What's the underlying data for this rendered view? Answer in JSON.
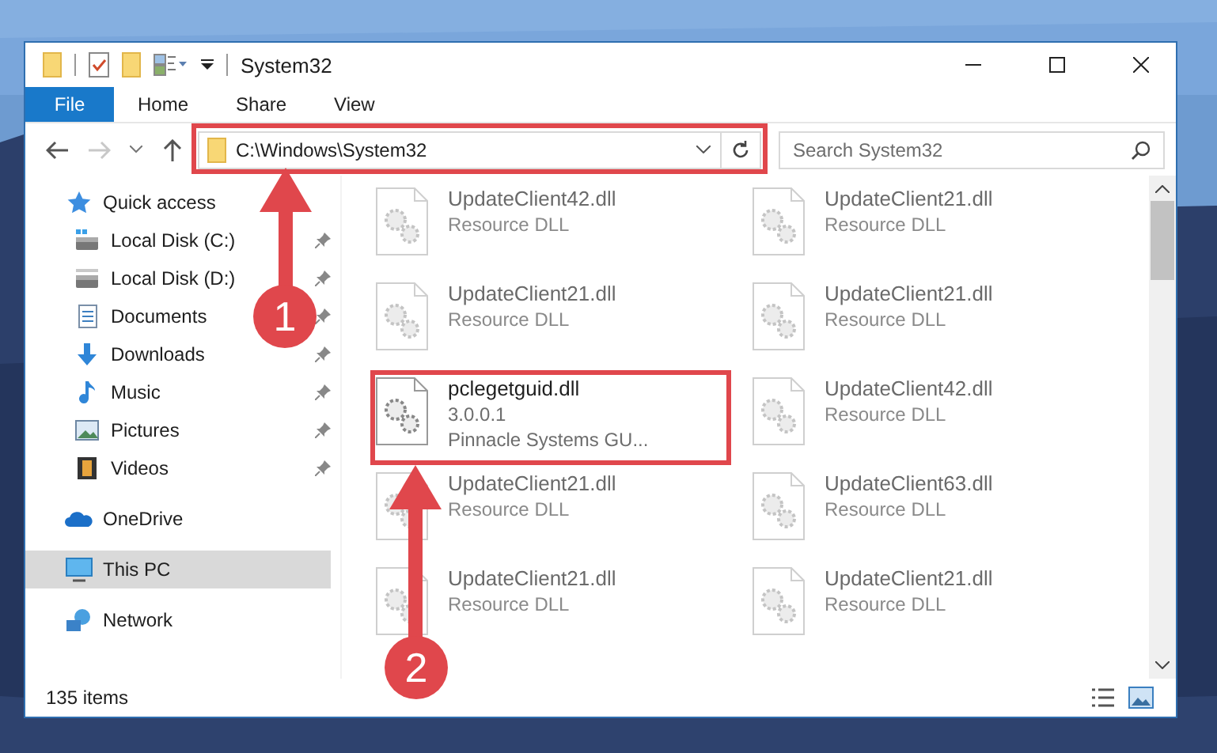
{
  "window": {
    "title": "System32"
  },
  "ribbon_tabs": [
    {
      "label": "File",
      "kind": "file",
      "selected": false
    },
    {
      "label": "Home",
      "kind": "tab",
      "selected": false
    },
    {
      "label": "Share",
      "kind": "tab",
      "selected": false
    },
    {
      "label": "View",
      "kind": "tab",
      "selected": false
    }
  ],
  "address": {
    "path": "C:\\Windows\\System32"
  },
  "search": {
    "placeholder": "Search System32"
  },
  "nav": [
    {
      "label": "Quick access",
      "selected": false,
      "children": [
        {
          "label": "Local Disk (C:)",
          "pinned": true,
          "selected": false
        },
        {
          "label": "Local Disk (D:)",
          "pinned": true,
          "selected": false
        },
        {
          "label": "Documents",
          "pinned": true,
          "selected": false
        },
        {
          "label": "Downloads",
          "pinned": true,
          "selected": false
        },
        {
          "label": "Music",
          "pinned": true,
          "selected": false
        },
        {
          "label": "Pictures",
          "pinned": true,
          "selected": false
        },
        {
          "label": "Videos",
          "pinned": true,
          "selected": false
        }
      ]
    },
    {
      "label": "OneDrive",
      "selected": false
    },
    {
      "label": "This PC",
      "selected": true
    },
    {
      "label": "Network",
      "selected": false
    }
  ],
  "files": [
    {
      "name": "UpdateClient42.dll",
      "details": [
        "Resource DLL"
      ],
      "blurred": true
    },
    {
      "name": "UpdateClient21.dll",
      "details": [
        "Resource DLL"
      ],
      "blurred": true
    },
    {
      "name": "UpdateClient21.dll",
      "details": [
        "Resource DLL"
      ],
      "blurred": true
    },
    {
      "name": "UpdateClient21.dll",
      "details": [
        "Resource DLL"
      ],
      "blurred": true
    },
    {
      "name": "pclegetguid.dll",
      "details": [
        "3.0.0.1",
        "Pinnacle Systems GU..."
      ],
      "blurred": false
    },
    {
      "name": "UpdateClient42.dll",
      "details": [
        "Resource DLL"
      ],
      "blurred": true
    },
    {
      "name": "UpdateClient21.dll",
      "details": [
        "Resource DLL"
      ],
      "blurred": true
    },
    {
      "name": "UpdateClient63.dll",
      "details": [
        "Resource DLL"
      ],
      "blurred": true
    },
    {
      "name": "UpdateClient21.dll",
      "details": [
        "Resource DLL"
      ],
      "blurred": true
    },
    {
      "name": "UpdateClient21.dll",
      "details": [
        "Resource DLL"
      ],
      "blurred": true
    }
  ],
  "status_bar": {
    "count": "135 items"
  },
  "annotations": [
    {
      "number": "1"
    },
    {
      "number": "2"
    }
  ]
}
